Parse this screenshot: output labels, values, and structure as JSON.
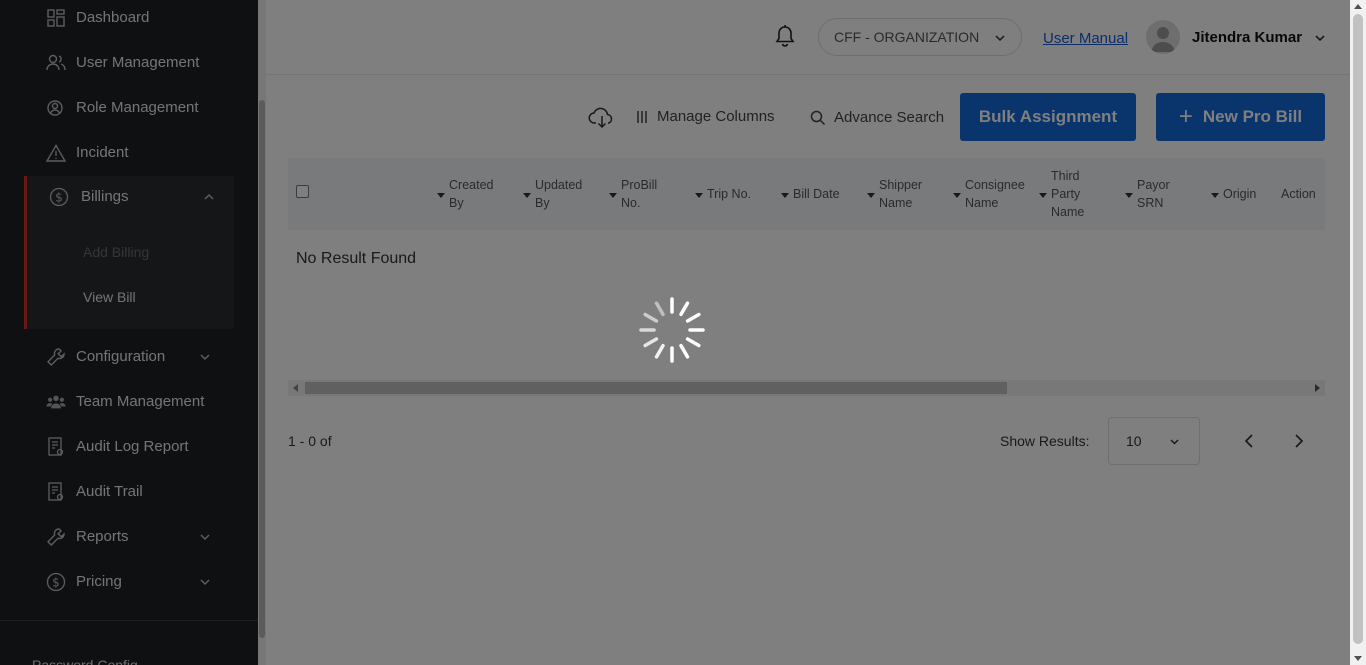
{
  "sidebar": {
    "items": [
      {
        "label": "Dashboard",
        "icon": "dashboard-icon"
      },
      {
        "label": "User Management",
        "icon": "users-icon"
      },
      {
        "label": "Role Management",
        "icon": "role-icon"
      },
      {
        "label": "Incident",
        "icon": "warning-icon"
      },
      {
        "label": "Billings",
        "icon": "dollar-icon"
      },
      {
        "label": "Configuration",
        "icon": "wrench-icon"
      },
      {
        "label": "Team Management",
        "icon": "team-icon"
      },
      {
        "label": "Audit Log Report",
        "icon": "report-icon"
      },
      {
        "label": "Audit Trail",
        "icon": "report-icon"
      },
      {
        "label": "Reports",
        "icon": "wrench-icon"
      },
      {
        "label": "Pricing",
        "icon": "dollar-icon"
      }
    ],
    "billing_sub": [
      "Add Billing",
      "View Bill"
    ],
    "footer_text": "Password Config..."
  },
  "header": {
    "organization": "CFF - ORGANIZATION",
    "user_manual": "User Manual",
    "user_name": "Jitendra Kumar"
  },
  "toolbar": {
    "manage_columns": "Manage Columns",
    "advance_search": "Advance Search",
    "bulk_assignment": "Bulk Assignment",
    "new_pro_bill": "New Pro Bill"
  },
  "table": {
    "columns": [
      [
        "Created",
        "By"
      ],
      [
        "Updated",
        "By"
      ],
      [
        "ProBill",
        "No."
      ],
      [
        "Trip No."
      ],
      [
        "Bill Date"
      ],
      [
        "Shipper",
        "Name"
      ],
      [
        "Consignee",
        "Name"
      ],
      [
        "Third",
        "Party",
        "Name"
      ],
      [
        "Payor",
        "SRN"
      ],
      [
        "Origin"
      ],
      [
        "Action"
      ]
    ],
    "empty_text": "No Result Found"
  },
  "pagination": {
    "range_text": "1 - 0 of",
    "show_results_label": "Show Results:",
    "page_size": "10"
  },
  "colors": {
    "primary": "#1268d8",
    "sidebar_bg": "#1e2124",
    "accent_red": "#d32f2f",
    "link": "#1e5ad1"
  }
}
